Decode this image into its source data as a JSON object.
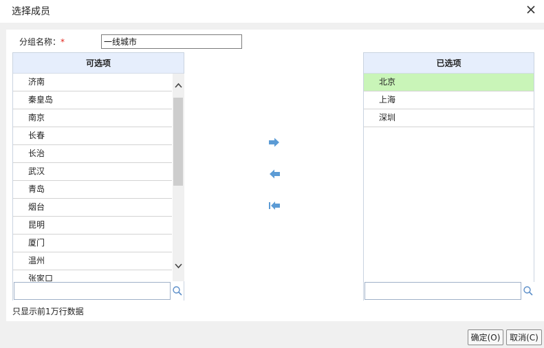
{
  "dialog": {
    "title": "选择成员"
  },
  "group": {
    "label": "分组名称：",
    "required_mark": "*",
    "value": "一线城市"
  },
  "available": {
    "header": "可选项",
    "items": [
      "济南",
      "秦皇岛",
      "南京",
      "长春",
      "长治",
      "武汉",
      "青岛",
      "烟台",
      "昆明",
      "厦门",
      "温州",
      "张家口"
    ]
  },
  "selected": {
    "header": "已选项",
    "items": [
      "北京",
      "上海",
      "深圳"
    ],
    "highlight_color": "#c9f5b8"
  },
  "footnote": "只显示前1万行数据",
  "buttons": {
    "ok": "确定(O)",
    "cancel": "取消(C)"
  },
  "icons": {
    "close": "close-icon",
    "search": "search-icon",
    "move_right": "arrow-right-icon",
    "move_left": "arrow-left-icon",
    "move_all_left": "arrow-left-all-icon"
  },
  "colors": {
    "header_bg": "#e6eefc",
    "arrow": "#5b9bd5"
  }
}
